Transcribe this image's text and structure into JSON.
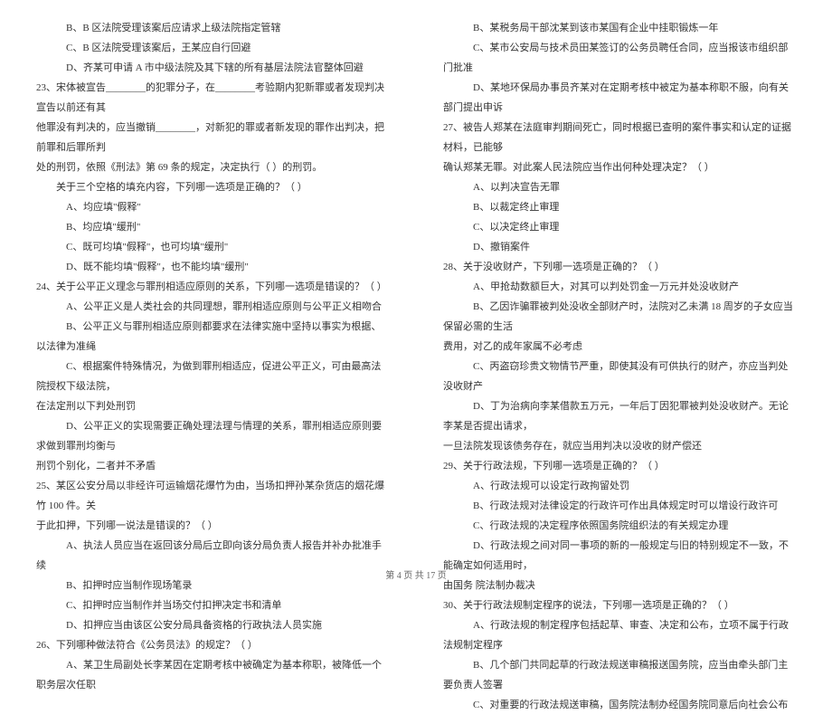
{
  "left": {
    "b22": "B、B 区法院受理该案后应请求上级法院指定管辖",
    "c22": "C、B 区法院受理该案后，王某应自行回避",
    "d22": "D、齐某可申请 A 市中级法院及其下辖的所有基层法院法官整体回避",
    "q23a": "23、宋体被宣告________的犯罪分子，在________考验期内犯新罪或者发现判决宣告以前还有其",
    "q23b": "他罪没有判决的，应当撤销________，对新犯的罪或者新发现的罪作出判决，把前罪和后罪所判",
    "q23c": "处的刑罚，依照《刑法》第 69 条的规定，决定执行（    ）的刑罚。",
    "q23d": "关于三个空格的填充内容，下列哪一选项是正确的？（    ）",
    "a23": "A、均应填\"假释\"",
    "b23": "B、均应填\"缓刑\"",
    "c23": "C、既可均填\"假释\"，也可均填\"缓刑\"",
    "d23": "D、既不能均填\"假释\"，也不能均填\"缓刑\"",
    "q24": "24、关于公平正义理念与罪刑相适应原则的关系，下列哪一选项是错误的？（    ）",
    "a24": "A、公平正义是人类社会的共同理想，罪刑相适应原则与公平正义相吻合",
    "b24": "B、公平正义与罪刑相适应原则都要求在法律实施中坚持以事实为根据、以法律为准绳",
    "c24a": "C、根据案件特殊情况，为做到罪刑相适应，促进公平正义，可由最高法院授权下级法院，",
    "c24b": "在法定刑以下判处刑罚",
    "d24a": "D、公平正义的实现需要正确处理法理与情理的关系，罪刑相适应原则要求做到罪刑均衡与",
    "d24b": "刑罚个别化，二者并不矛盾",
    "q25a": "25、某区公安分局以非经许可运输烟花爆竹为由，当场扣押孙某杂货店的烟花爆竹 100 件。关",
    "q25b": "于此扣押，下列哪一说法是错误的？（    ）",
    "a25": "A、执法人员应当在返回该分局后立即向该分局负责人报告并补办批准手续",
    "b25": "B、扣押时应当制作现场笔录",
    "c25": "C、扣押时应当制作并当场交付扣押决定书和清单",
    "d25": "D、扣押应当由该区公安分局具备资格的行政执法人员实施",
    "q26": "26、下列哪种做法符合《公务员法》的规定？（    ）",
    "a26": "A、某卫生局副处长李某因在定期考核中被确定为基本称职，被降低一个职务层次任职"
  },
  "right": {
    "b26": "B、某税务局干部沈某到该市某国有企业中挂职锻炼一年",
    "c26": "C、某市公安局与技术员田某签订的公务员聘任合同，应当报该市组织部门批准",
    "d26": "D、某地环保局办事员齐某对在定期考核中被定为基本称职不服，向有关部门提出申诉",
    "q27a": "27、被告人郑某在法庭审判期间死亡，同时根据已查明的案件事实和认定的证据材料，已能够",
    "q27b": "确认郑某无罪。对此案人民法院应当作出何种处理决定？（    ）",
    "a27": "A、以判决宣告无罪",
    "b27": "B、以裁定终止审理",
    "c27": "C、以决定终止审理",
    "d27": "D、撤销案件",
    "q28": "28、关于没收财产，下列哪一选项是正确的？（    ）",
    "a28": "A、甲抢劫数额巨大，对其可以判处罚金一万元并处没收财产",
    "b28a": "B、乙因诈骗罪被判处没收全部财产时，法院对乙未满 18 周岁的子女应当保留必需的生活",
    "b28b": "费用，对乙的成年家属不必考虑",
    "c28": "C、丙盗窃珍贵文物情节严重，即使其没有可供执行的财产，亦应当判处没收财产",
    "d28a": "D、丁为治病向李某借款五万元，一年后丁因犯罪被判处没收财产。无论李某是否提出请求，",
    "d28b": "一旦法院发现该债务存在，就应当用判决以没收的财产偿还",
    "q29": "29、关于行政法规，下列哪一选项是正确的？（    ）",
    "a29": "A、行政法规可以设定行政拘留处罚",
    "b29": "B、行政法规对法律设定的行政许可作出具体规定时可以增设行政许可",
    "c29": "C、行政法规的决定程序依照国务院组织法的有关规定办理",
    "d29a": "D、行政法规之间对同一事项的新的一般规定与旧的特别规定不一致，不能确定如何适用时，",
    "d29b": "由国务  院法制办裁决",
    "q30": "30、关于行政法规制定程序的说法，下列哪一选项是正确的？（    ）",
    "a30": "A、行政法规的制定程序包括起草、审查、决定和公布，立项不属于行政法规制定程序",
    "b30": "B、几个部门共同起草的行政法规送审稿报送国务院，应当由牵头部门主要负责人签署",
    "c30": "C、对重要的行政法规送审稿，国务院法制办经国务院同意后向社会公布"
  },
  "footer": "第 4 页 共 17 页"
}
